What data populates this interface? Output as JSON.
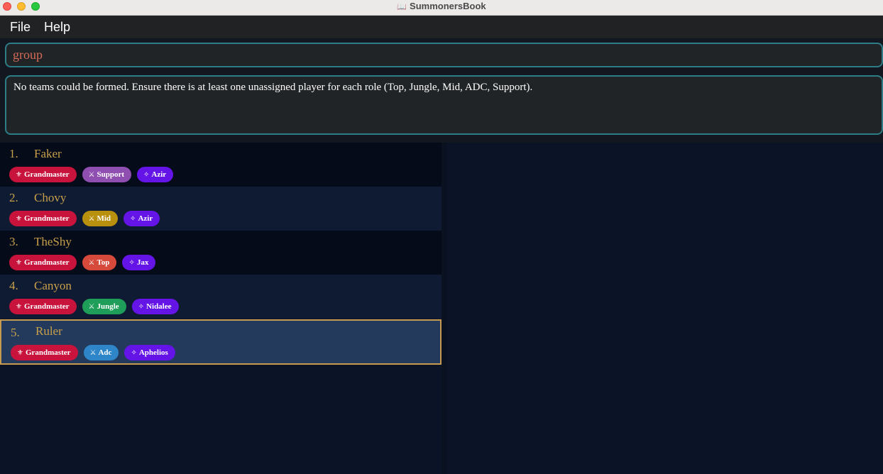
{
  "window": {
    "title": "SummonersBook"
  },
  "menu": {
    "file": "File",
    "help": "Help"
  },
  "command": {
    "value": "group"
  },
  "result": {
    "text": "No teams could be formed. Ensure there is at least one unassigned player for each role (Top, Jungle, Mid, ADC, Support)."
  },
  "icons": {
    "rank": "fleur-de-lis-icon",
    "role": "crossed-swords-icon",
    "champion": "sparkle-icon"
  },
  "colors": {
    "rank_tag": "#c8133c",
    "champion_tag": "#6414e6",
    "accent_text": "#c8a04a",
    "command_text": "#d36b57",
    "border_accent": "#2d7c86",
    "selected_border": "#c79a52"
  },
  "players": [
    {
      "index": "1.",
      "name": "Faker",
      "rank": "Grandmaster",
      "role": "Support",
      "role_color": "#8f4fb0",
      "champion": "Azir",
      "selected": false
    },
    {
      "index": "2.",
      "name": "Chovy",
      "rank": "Grandmaster",
      "role": "Mid",
      "role_color": "#b8900e",
      "champion": "Azir",
      "selected": false
    },
    {
      "index": "3.",
      "name": "TheShy",
      "rank": "Grandmaster",
      "role": "Top",
      "role_color": "#d54a3a",
      "champion": "Jax",
      "selected": false
    },
    {
      "index": "4.",
      "name": "Canyon",
      "rank": "Grandmaster",
      "role": "Jungle",
      "role_color": "#1f9e5a",
      "champion": "Nidalee",
      "selected": false
    },
    {
      "index": "5.",
      "name": "Ruler",
      "rank": "Grandmaster",
      "role": "Adc",
      "role_color": "#2e86c8",
      "champion": "Aphelios",
      "selected": true
    }
  ]
}
